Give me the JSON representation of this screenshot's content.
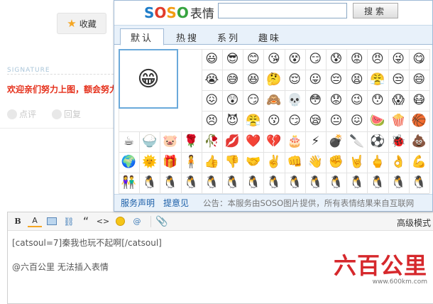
{
  "page": {
    "favorite_label": "收藏",
    "signature_label": "SIGNATURE",
    "signature_text": "欢迎亲们努力上图，额会努力",
    "action_comment": "点评",
    "action_reply": "回复"
  },
  "popup": {
    "brand_letters": [
      "S",
      "O",
      "S",
      "O"
    ],
    "brand_suffix": "表情",
    "search_placeholder": "",
    "search_button": "搜索",
    "tabs": [
      {
        "label": "默认",
        "active": true
      },
      {
        "label": "热搜",
        "active": false
      },
      {
        "label": "系列",
        "active": false
      },
      {
        "label": "趣味",
        "active": false
      }
    ],
    "preview_emoji": "😁",
    "emoji_rows": [
      [
        "😃",
        "😎",
        "😊",
        "😘",
        "😵",
        "😏",
        "😰",
        "😡",
        "😠",
        "😜",
        "😋"
      ],
      [
        "😭",
        "😅",
        "😆",
        "🤔",
        "😌",
        "😛",
        "😔",
        "😫",
        "😤",
        "😒",
        "😄"
      ],
      [
        "😖",
        "😲",
        "😏",
        "🙈",
        "💀",
        "😳",
        "😟",
        "😉",
        "😯",
        "😱",
        "😷"
      ],
      [
        "😣",
        "😈",
        "😤",
        "😗",
        "😏",
        "😪",
        "😐",
        "😖",
        "🍉",
        "🍿",
        "🏀"
      ],
      [
        "☕",
        "🍚",
        "🐷",
        "🌹",
        "🥀",
        "💋",
        "❤️",
        "💔",
        "🎂",
        "⚡",
        "💣",
        "🔪",
        "⚽",
        "🐞",
        "💩"
      ],
      [
        "🌍",
        "🌞",
        "🎁",
        "🧍",
        "👍",
        "👎",
        "🤝",
        "✌️",
        "👊",
        "👋",
        "✊",
        "🤘",
        "🖕",
        "👌",
        "💪"
      ],
      [
        "👫",
        "🐧",
        "🐧",
        "🐧",
        "🐧",
        "🐧",
        "🐧",
        "🐧",
        "🐧",
        "🐧",
        "🐧",
        "🐧",
        "🐧",
        "🐧",
        "🐧"
      ]
    ],
    "footer_links": [
      "服务声明",
      "提意见"
    ],
    "footer_notice": "公告：本服务由SOSO图片提供，所有表情结果来自互联网"
  },
  "editor": {
    "toolbar": {
      "bold": "B",
      "color": "A",
      "quote": "“",
      "code": "<>",
      "at": "@",
      "advanced_mode": "高级模式"
    },
    "line1": "[catsoul=7]秦我也玩不起啊[/catsoul]",
    "line2": "@六百公里 无法插入表情"
  },
  "watermark": {
    "logo": "六百公里",
    "url": "www.600km.com"
  },
  "colors": {
    "accent_blue": "#1b5fa8",
    "signature_red": "#e5301b",
    "popup_border": "#9fb9d6",
    "tab_bg": "#e8f1fa"
  }
}
